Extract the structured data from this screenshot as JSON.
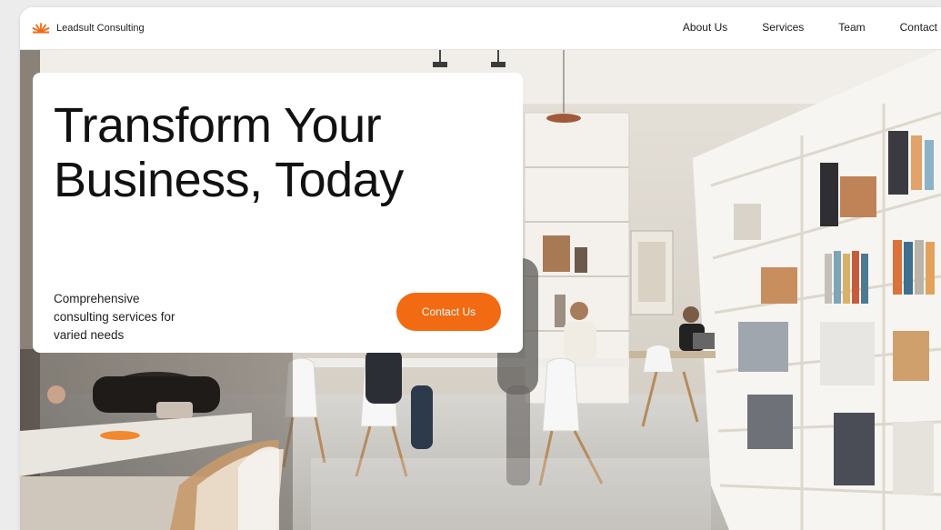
{
  "brand": {
    "name": "Leadsult Consulting",
    "logo_icon": "sun-rays-icon",
    "accent_color": "#f26a12"
  },
  "nav": {
    "items": [
      {
        "label": "About Us"
      },
      {
        "label": "Services"
      },
      {
        "label": "Team"
      },
      {
        "label": "Contact"
      }
    ]
  },
  "hero": {
    "headline_line1": "Transform Your",
    "headline_line2": "Business, Today",
    "subtext": "Comprehensive consulting services for varied needs",
    "cta_label": "Contact Us",
    "cta_color": "#f26a12",
    "background_image": "office-workspace-photo"
  }
}
